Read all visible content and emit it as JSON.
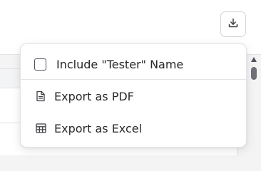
{
  "toolbar": {
    "download_icon": "download-icon"
  },
  "export_menu": {
    "include_tester": {
      "label": "Include \"Tester\" Name",
      "checked": false
    },
    "items": [
      {
        "label": "Export as PDF",
        "icon": "file-text-icon"
      },
      {
        "label": "Export as Excel",
        "icon": "table-icon"
      }
    ]
  },
  "colors": {
    "text": "#27272a",
    "border": "#e4e4e7",
    "icon": "#3f3f46",
    "background": "#f4f4f5"
  }
}
